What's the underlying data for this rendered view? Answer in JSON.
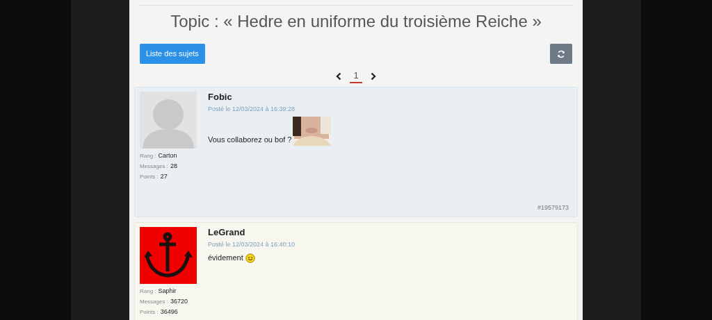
{
  "title": "Topic : « Hedre en uniforme du troisième Reiche »",
  "toolbar": {
    "topics_button": "Liste des sujets"
  },
  "pagination": {
    "pages": [
      {
        "label": "1",
        "selected": true
      }
    ]
  },
  "posts": [
    {
      "author": "Fobic",
      "avatar": {
        "kind": "silhouette"
      },
      "date": "Posté le 12/03/2024 à 16:39:28",
      "body": "Vous collaborez ou bof ?",
      "stats": [
        {
          "label": "Rang :",
          "value": "Carton"
        },
        {
          "label": "Messages :",
          "value": "28"
        },
        {
          "label": "Points :",
          "value": "27"
        }
      ],
      "post_id": "#19579173"
    },
    {
      "author": "LeGrand",
      "avatar": {
        "kind": "anchor"
      },
      "date": "Posté le 12/03/2024 à 16:40:10",
      "body": "évidement",
      "emoji": {
        "kind": "smile"
      },
      "stats": [
        {
          "label": "Rang :",
          "value": "Saphir"
        },
        {
          "label": "Messages :",
          "value": "36720"
        },
        {
          "label": "Points :",
          "value": "36496"
        }
      ]
    }
  ]
}
